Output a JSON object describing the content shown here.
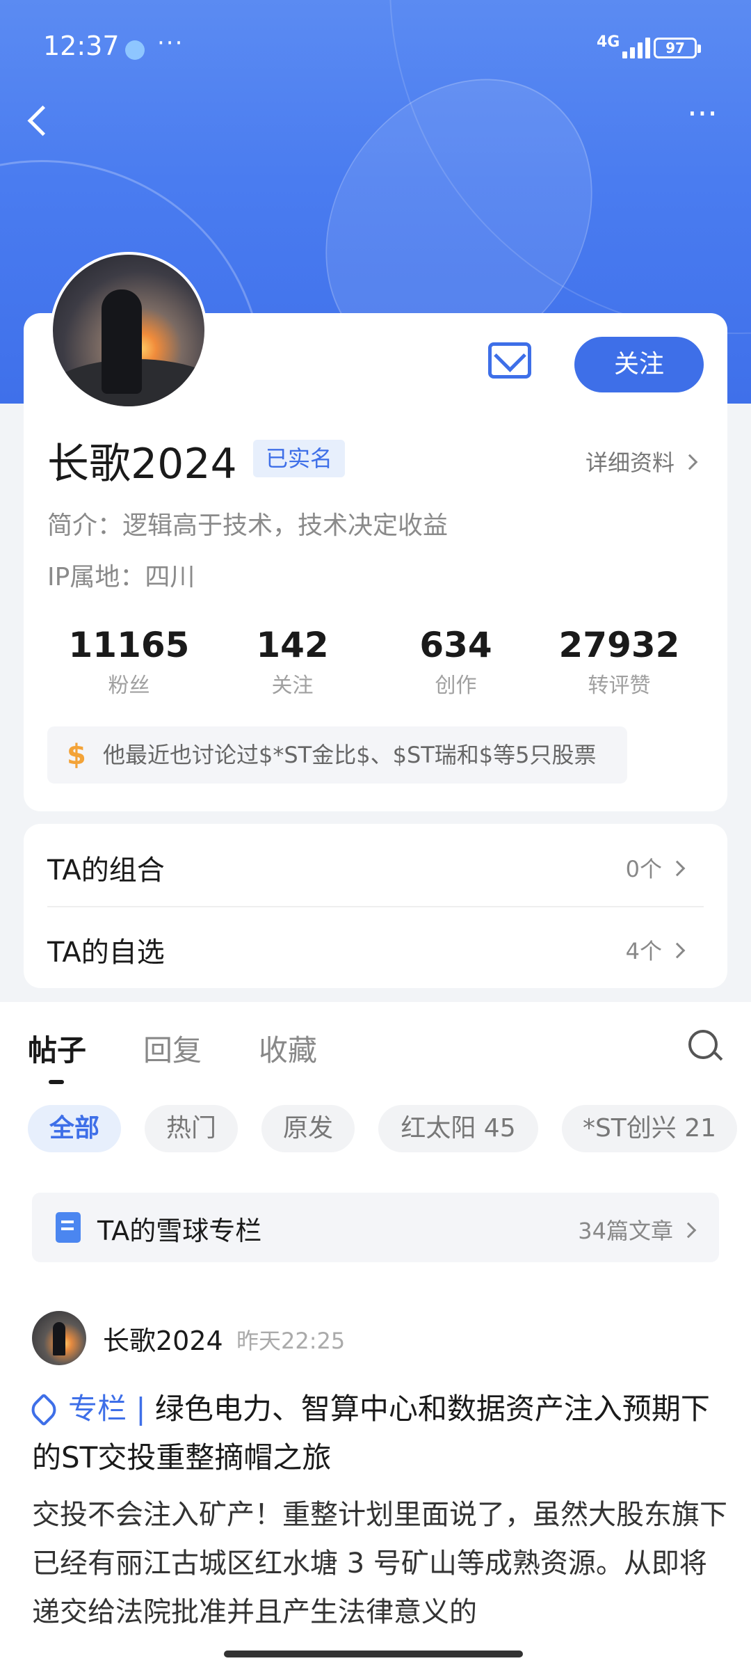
{
  "status_bar": {
    "time": "12:37",
    "network": "4G",
    "battery": "97"
  },
  "profile": {
    "name": "长歌2024",
    "verified_badge": "已实名",
    "detail_link": "详细资料",
    "bio": "简介：逻辑高于技术，技术决定收益",
    "ip_location": "IP属地：四川",
    "follow_label": "关注",
    "stats": [
      {
        "value": "11165",
        "label": "粉丝"
      },
      {
        "value": "142",
        "label": "关注"
      },
      {
        "value": "634",
        "label": "创作"
      },
      {
        "value": "27932",
        "label": "转评赞"
      }
    ],
    "stock_tip": "他最近也讨论过$*ST金比$、$ST瑞和$等5只股票",
    "stock_tip_icon": "$"
  },
  "collections": [
    {
      "label": "TA的组合",
      "count": "0个"
    },
    {
      "label": "TA的自选",
      "count": "4个"
    }
  ],
  "tabs": [
    "帖子",
    "回复",
    "收藏"
  ],
  "chips": [
    "全部",
    "热门",
    "原发",
    "红太阳 45",
    "*ST创兴 21"
  ],
  "column": {
    "title": "TA的雪球专栏",
    "count": "34篇文章"
  },
  "post": {
    "author": "长歌2024",
    "time": "昨天22:25",
    "tag": "专栏 |",
    "title": "绿色电力、智算中心和数据资产注入预期下的ST交投重整摘帽之旅",
    "body": "交投不会注入矿产！重整计划里面说了，虽然大股东旗下已经有丽江古城区红水塘 3 号矿山等成熟资源。从即将递交给法院批准并且产生法律意义的"
  },
  "colors": {
    "accent": "#3e6fe8",
    "header": "#4a7cf0"
  }
}
